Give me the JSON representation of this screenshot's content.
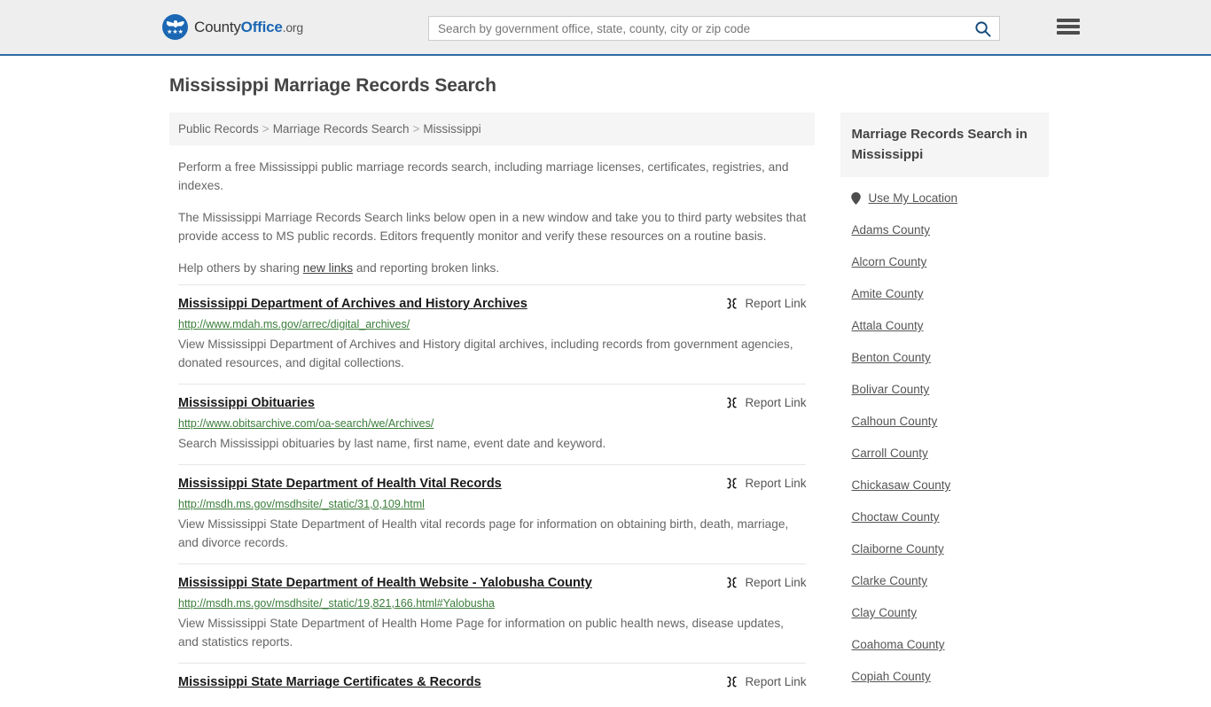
{
  "header": {
    "brand": {
      "county": "County",
      "office": "Office",
      "org": ".org",
      "logo_icon": "countyoffice-eagle-logo",
      "stars": "★★★"
    },
    "search": {
      "placeholder": "Search by government office, state, county, city or zip code",
      "value": "",
      "search_icon": "search-icon"
    },
    "menu_icon": "hamburger-menu-icon"
  },
  "page": {
    "title": "Mississippi Marriage Records Search"
  },
  "breadcrumb": {
    "separator": ">",
    "items": [
      {
        "label": "Public Records"
      },
      {
        "label": "Marriage Records Search"
      },
      {
        "label": "Mississippi"
      }
    ]
  },
  "intro": {
    "p1": "Perform a free Mississippi public marriage records search, including marriage licenses, certificates, registries, and indexes.",
    "p2": "The Mississippi Marriage Records Search links below open in a new window and take you to third party websites that provide access to MS public records. Editors frequently monitor and verify these resources on a routine basis.",
    "p3_before": "Help others by sharing ",
    "p3_link": "new links",
    "p3_after": " and reporting broken links."
  },
  "results": {
    "report_label": "Report Link",
    "report_icon": "broken-link-icon",
    "items": [
      {
        "title": "Mississippi Department of Archives and History Archives",
        "url": "http://www.mdah.ms.gov/arrec/digital_archives/",
        "description": "View Mississippi Department of Archives and History digital archives, including records from government agencies, donated resources, and digital collections."
      },
      {
        "title": "Mississippi Obituaries",
        "url": "http://www.obitsarchive.com/oa-search/we/Archives/",
        "description": "Search Mississippi obituaries by last name, first name, event date and keyword."
      },
      {
        "title": "Mississippi State Department of Health Vital Records",
        "url": "http://msdh.ms.gov/msdhsite/_static/31,0,109.html",
        "description": "View Mississippi State Department of Health vital records page for information on obtaining birth, death, marriage, and divorce records."
      },
      {
        "title": "Mississippi State Department of Health Website - Yalobusha County",
        "url": "http://msdh.ms.gov/msdhsite/_static/19,821,166.html#Yalobusha",
        "description": "View Mississippi State Department of Health Home Page for information on public health news, disease updates, and statistics reports."
      },
      {
        "title": "Mississippi State Marriage Certificates & Records",
        "url": "",
        "description": ""
      }
    ]
  },
  "sidebar": {
    "heading": "Marriage Records Search in Mississippi",
    "location": {
      "label": "Use My Location",
      "icon": "map-pin-icon"
    },
    "counties": [
      {
        "label": "Adams County"
      },
      {
        "label": "Alcorn County"
      },
      {
        "label": "Amite County"
      },
      {
        "label": "Attala County"
      },
      {
        "label": "Benton County"
      },
      {
        "label": "Bolivar County"
      },
      {
        "label": "Calhoun County"
      },
      {
        "label": "Carroll County"
      },
      {
        "label": "Chickasaw County"
      },
      {
        "label": "Choctaw County"
      },
      {
        "label": "Claiborne County"
      },
      {
        "label": "Clarke County"
      },
      {
        "label": "Clay County"
      },
      {
        "label": "Coahoma County"
      },
      {
        "label": "Copiah County"
      }
    ]
  },
  "colors": {
    "brand_blue": "#1b67b3",
    "header_bg": "#eeeeee",
    "header_border": "#2d6ca2",
    "url_green": "#3a7d3a",
    "panel_bg": "#f5f5f5"
  }
}
